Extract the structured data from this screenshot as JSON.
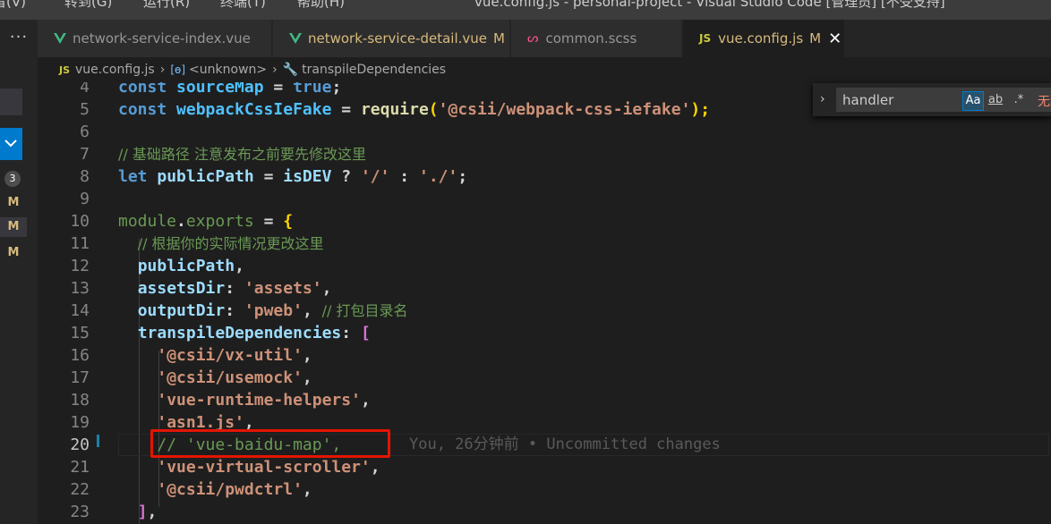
{
  "titlebar": {
    "menu": [
      "看(V)",
      "转到(G)",
      "运行(R)",
      "终端(T)",
      "帮助(H)"
    ],
    "title": "vue.config.js - personal-project - Visual Studio Code [管理员] [不受支持]"
  },
  "activity": {
    "more_label": "···",
    "badge_count": "3",
    "modified_markers": [
      "M",
      "M",
      "M"
    ]
  },
  "tabs": [
    {
      "label": "network-service-index.vue",
      "icon": "vue-icon",
      "modified": ""
    },
    {
      "label": "network-service-detail.vue",
      "icon": "vue-icon",
      "modified": "M"
    },
    {
      "label": "common.scss",
      "icon": "scss-icon",
      "modified": ""
    },
    {
      "label": "vue.config.js",
      "icon": "js-icon",
      "modified": "M",
      "close": "✕"
    }
  ],
  "tab_icons": {
    "js": "JS",
    "scss": "ᔕ",
    "chevron": "›",
    "var": "[ɵ]",
    "wrench": "🔧"
  },
  "breadcrumb": {
    "file": "vue.config.js",
    "scope": "<unknown>",
    "symbol": "transpileDependencies"
  },
  "find": {
    "toggle": "›",
    "query": "handler",
    "opt_case": "Aa",
    "opt_word": "ab",
    "opt_regex": ".*",
    "result": "无结果"
  },
  "editor": {
    "line_numbers": [
      "4",
      "5",
      "6",
      "7",
      "8",
      "9",
      "10",
      "11",
      "12",
      "13",
      "14",
      "15",
      "16",
      "17",
      "18",
      "19",
      "20",
      "21",
      "22",
      "23"
    ],
    "current_line": "20",
    "blame": "You, 26分钟前 • Uncommitted changes",
    "lines": {
      "l4": [
        "const",
        " sourceMap",
        " = ",
        "true",
        ";"
      ],
      "l5": [
        "const",
        " webpackCssIeFake",
        " = ",
        "require",
        "(",
        "'@csii/webpack-css-iefake'",
        ");"
      ],
      "l7": [
        "// 基础路径 注意发布之前要先修改这里"
      ],
      "l8": [
        "let",
        " publicPath",
        " = ",
        "isDEV",
        " ? ",
        "'/'",
        " : ",
        "'./'",
        ";"
      ],
      "l10": [
        "module",
        ".",
        "exports",
        " = ",
        "{"
      ],
      "l11": [
        "// 根据你的实际情况更改这里"
      ],
      "l12": [
        "publicPath",
        ","
      ],
      "l13": [
        "assetsDir",
        ": ",
        "'assets'",
        ","
      ],
      "l14": [
        "outputDir",
        ": ",
        "'pweb'",
        ", ",
        "// 打包目录名"
      ],
      "l15": [
        "transpileDependencies",
        ": ",
        "["
      ],
      "l16": [
        "'@csii/vx-util'",
        ","
      ],
      "l17": [
        "'@csii/usemock'",
        ","
      ],
      "l18": [
        "'vue-runtime-helpers'",
        ","
      ],
      "l19": [
        "'asn1.js'",
        ","
      ],
      "l20": [
        "// 'vue-baidu-map',"
      ],
      "l21": [
        "'vue-virtual-scroller'",
        ","
      ],
      "l22": [
        "'@csii/pwdctrl'",
        ","
      ],
      "l23": [
        "]",
        ","
      ]
    }
  },
  "colors": {
    "keyword": "#569cd6",
    "string": "#ce9178",
    "comment": "#6a9955",
    "highlight_box": "#e51400"
  }
}
